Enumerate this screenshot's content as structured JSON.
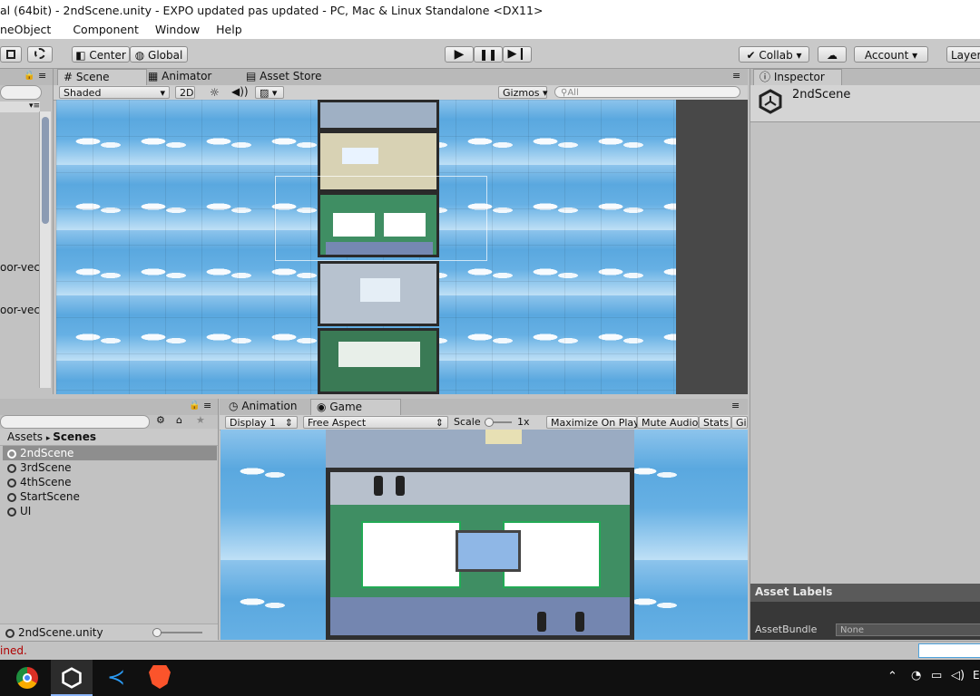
{
  "window": {
    "title": "al (64bit) - 2ndScene.unity - EXPO updated pas updated - PC, Mac & Linux Standalone <DX11>"
  },
  "menu": [
    "neObject",
    "Component",
    "Window",
    "Help"
  ],
  "toolbar": {
    "center": "Center",
    "global": "Global",
    "collab": "Collab",
    "account": "Account",
    "layers": "Layer"
  },
  "scene": {
    "tabs": {
      "scene": "Scene",
      "animator": "Animator",
      "asset_store": "Asset Store"
    },
    "shading": "Shaded",
    "mode_2d": "2D",
    "gizmos": "Gizmos",
    "search_placeholder": "All"
  },
  "hierarchy": {
    "items": [
      "oor-vec",
      "oor-vec"
    ]
  },
  "inspector": {
    "tab": "Inspector",
    "object_name": "2ndScene",
    "asset_labels": "Asset Labels",
    "asset_bundle_label": "AssetBundle",
    "asset_bundle_value": "None"
  },
  "project": {
    "breadcrumb_root": "Assets",
    "breadcrumb_child": "Scenes",
    "items": [
      "2ndScene",
      "3rdScene",
      "4thScene",
      "StartScene",
      "UI"
    ],
    "footer_file": "2ndScene.unity"
  },
  "game": {
    "tabs": {
      "animation": "Animation",
      "game": "Game"
    },
    "display": "Display 1",
    "aspect": "Free Aspect",
    "scale_label": "Scale",
    "scale_value": "1x",
    "maximize": "Maximize On Play",
    "mute": "Mute Audio",
    "stats": "Stats",
    "gizmos": "Gi"
  },
  "status": {
    "message": "ined."
  },
  "colors": {
    "sky": "#5aa8df",
    "wall_green": "#3f8e63",
    "accent": "#4fa3dd"
  }
}
